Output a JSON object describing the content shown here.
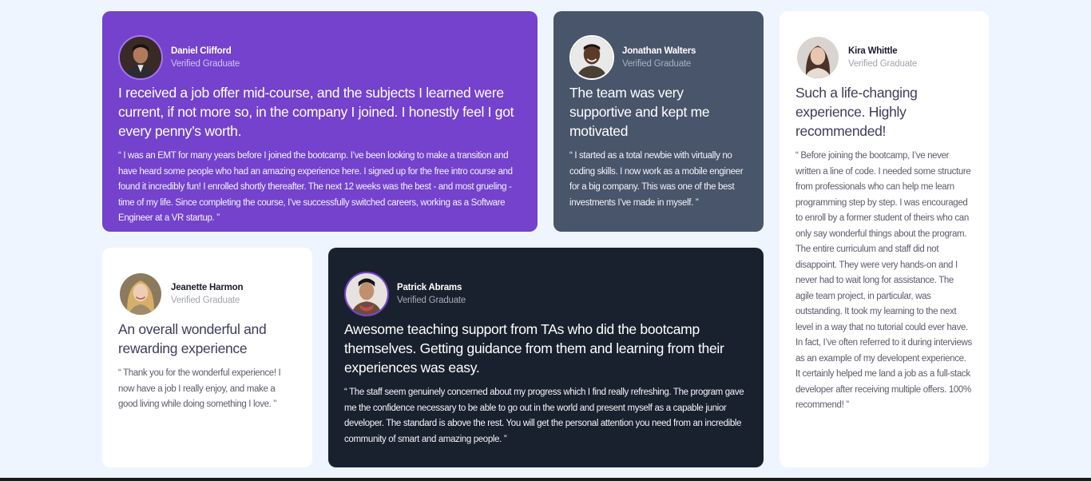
{
  "testimonials": [
    {
      "name": "Daniel Clifford",
      "role": "Verified Graduate",
      "headline": "I received a job offer mid-course, and the subjects I learned were current, if not more so, in the company I joined. I honestly feel I got every penny’s worth.",
      "quote": "“ I was an EMT for many years before I joined the bootcamp. I’ve been looking to make a transition and have heard some people who had an amazing experience here. I signed up for the free intro course and found it incredibly fun! I enrolled shortly thereafter. The next 12 weeks was the best - and most grueling - time of my life. Since completing the course, I’ve successfully switched careers, working as a Software Engineer at a VR startup. ”",
      "avatar_icon": "person-avatar-icon",
      "background": "#7442cc"
    },
    {
      "name": "Jonathan Walters",
      "role": "Verified Graduate",
      "headline": "The team was very supportive and kept me motivated",
      "quote": "“ I started as a total newbie with virtually no coding skills. I now work as a mobile engineer for a big company. This was one of the best investments I’ve made in myself. ”",
      "avatar_icon": "person-avatar-icon",
      "background": "#48556a"
    },
    {
      "name": "Kira Whittle",
      "role": "Verified Graduate",
      "headline": "Such a life-changing experience. Highly recommended!",
      "quote": "“ Before joining the bootcamp, I’ve never written a line of code. I needed some structure from professionals who can help me learn programming step by step. I was encouraged to enroll by a former student of theirs who can only say wonderful things about the program. The entire curriculum and staff did not disappoint. They were very hands-on and I never had to wait long for assistance. The agile team project, in particular, was outstanding. It took my learning to the next level in a way that no tutorial could ever have. In fact, I’ve often referred to it during interviews as an example of my developent experience. It certainly helped me land a job as a full-stack developer after receiving multiple offers. 100% recommend! ”",
      "avatar_icon": "person-avatar-icon",
      "background": "#ffffff"
    },
    {
      "name": "Jeanette Harmon",
      "role": "Verified Graduate",
      "headline": "An overall wonderful and rewarding experience",
      "quote": "“ Thank you for the wonderful experience! I now have a job I really enjoy, and make a good living while doing something I love. ”",
      "avatar_icon": "person-avatar-icon",
      "background": "#ffffff"
    },
    {
      "name": "Patrick Abrams",
      "role": "Verified Graduate",
      "headline": "Awesome teaching support from TAs who did the bootcamp themselves. Getting guidance from them and learning from their experiences was easy.",
      "quote": "“ The staff seem genuinely concerned about my progress which I find really refreshing. The program gave me the confidence necessary to be able to go out in the world and present myself as a capable junior developer. The standard is above the rest. You will get the personal attention you need from an incredible community of smart and amazing people. ”",
      "avatar_icon": "person-avatar-icon",
      "background": "#19212e"
    }
  ]
}
